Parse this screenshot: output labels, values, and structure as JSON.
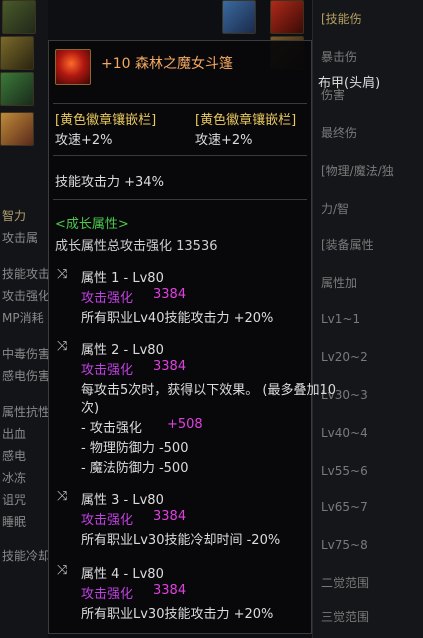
{
  "item": {
    "name": "+10 森林之魔女斗篷",
    "type": "布甲(头肩)"
  },
  "emblem_slots": [
    {
      "label": "[黄色徽章镶嵌栏]",
      "value": "攻速+2%"
    },
    {
      "label": "[黄色徽章镶嵌栏]",
      "value": "攻速+2%"
    }
  ],
  "skill_attack": "技能攻击力 +34%",
  "growth": {
    "header": "<成长属性>",
    "total": "成长属性总攻击强化 13536"
  },
  "attributes": [
    {
      "title": "属性 1 - Lv80",
      "strength_label": "攻击强化",
      "strength_value": "3384",
      "desc": "所有职业Lv40技能攻击力 +20%"
    },
    {
      "title": "属性 2 - Lv80",
      "strength_label": "攻击强化",
      "strength_value": "3384",
      "desc_line1": "每攻击5次时，获得以下效果。 (最多叠加10",
      "desc_line2": "次)",
      "effects": [
        {
          "label": "- 攻击强化",
          "value": "+508"
        },
        {
          "label": "- 物理防御力 -500"
        },
        {
          "label": "- 魔法防御力 -500"
        }
      ]
    },
    {
      "title": "属性 3 - Lv80",
      "strength_label": "攻击强化",
      "strength_value": "3384",
      "desc": "所有职业Lv30技能冷却时间 -20%"
    },
    {
      "title": "属性 4 - Lv80",
      "strength_label": "攻击强化",
      "strength_value": "3384",
      "desc": "所有职业Lv30技能攻击力 +20%"
    }
  ],
  "background": {
    "left_rows": [
      "智力",
      "攻击属",
      "技能攻击",
      "攻击强化",
      "MP消耗",
      "中毒伤害",
      "感电伤害",
      "属性抗性",
      "出血",
      "感电",
      "冰冻",
      "诅咒",
      "睡眠",
      "技能冷却"
    ],
    "right_rows": [
      "[技能伤",
      "暴击伤",
      "伤害",
      "最终伤",
      "[物理/魔法/独",
      "力/智",
      "[装备属性",
      "属性加",
      "Lv1~1",
      "Lv20~2",
      "Lv30~3",
      "Lv40~4",
      "Lv55~6",
      "Lv65~7",
      "Lv75~8",
      "二觉范围",
      "三觉范围"
    ]
  },
  "colors": {
    "gold": "#e8c860",
    "green": "#4cc94c",
    "purple": "#c040e0",
    "item_name": "#f4a860"
  }
}
